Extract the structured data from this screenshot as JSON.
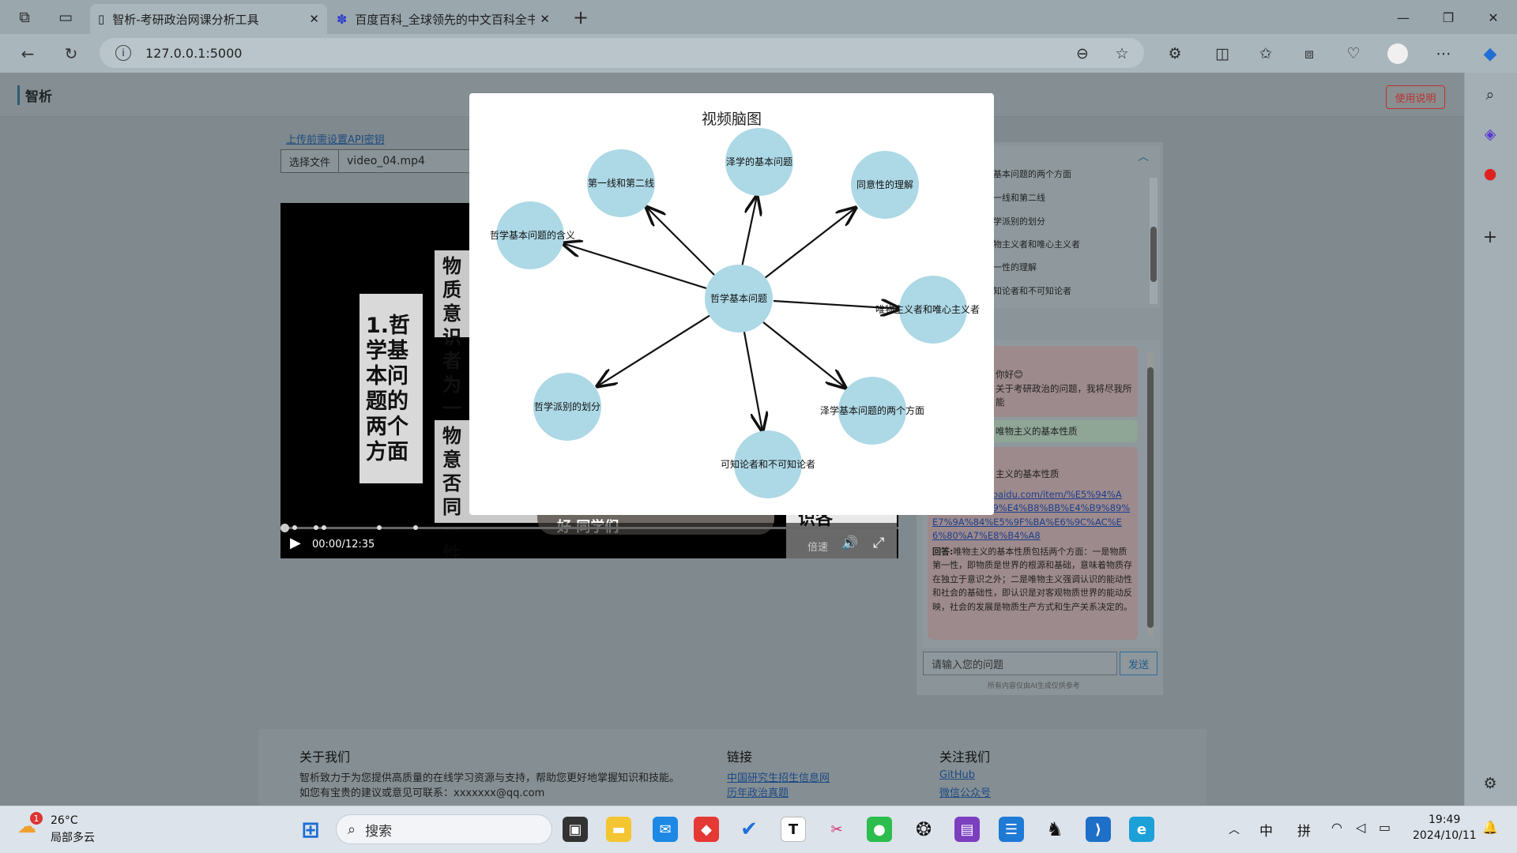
{
  "browser": {
    "tabs": [
      {
        "title": "智析-考研政治网课分析工具",
        "close": "✕"
      },
      {
        "title": "百度百科_全球领先的中文百科全书",
        "close": "✕"
      }
    ],
    "new_tab": "+",
    "url": "127.0.0.1:5000",
    "win": {
      "min": "—",
      "max": "❐",
      "close": "✕"
    }
  },
  "app": {
    "brand": "智析",
    "help_button": "使用说明",
    "api_link": "上传前需设置API密钥",
    "file_button": "选择文件",
    "file_name": "video_04.mp4"
  },
  "video": {
    "slide_title": "1.哲学基本问题的两个方面",
    "slide_right_1": "物质意识者为一性",
    "slide_right_2": "物意否同一性",
    "bottom_text": "好 同学们",
    "side_text": "识各",
    "time": "00:00/12:35",
    "speed": "倍速"
  },
  "outline": {
    "items": [
      "基本问题的两个方面",
      "一线和第二线",
      "学派别的划分",
      "物主义者和唯心主义者",
      "一性的理解",
      "知论者和不可知论者"
    ]
  },
  "chat": {
    "greeting": "你好😊",
    "intro": "关于考研政治的问题，我将尽我所能",
    "user_q": "唯物主义的基本性质",
    "bot_q": "主义的基本性质",
    "link": "https://baike.baidu.com/item/%E5%94%A F%E7%89%A9%E4%B8%BB%E4%B9%89%E7%9A%84%E5%9F%BA%E6%9C%AC%E6%80%A7%E8%B4%A8",
    "answer_label": "回答:",
    "answer": "唯物主义的基本性质包括两个方面：一是物质第一性，即物质是世界的根源和基础，意味着物质存在独立于意识之外；二是唯物主义强调认识的能动性和社会的基础性，即认识是对客观物质世界的能动反映，社会的发展是物质生产方式和生产关系决定的。",
    "input_placeholder": "请输入您的问题",
    "send": "发送",
    "disclaimer": "所有内容仅由AI生成仅供参考"
  },
  "footer": {
    "about_title": "关于我们",
    "about_1": "智析致力于为您提供高质量的在线学习资源与支持，帮助您更好地掌握知识和技能。",
    "about_2": "如您有宝贵的建议或意见可联系：xxxxxxx@qq.com",
    "links_title": "链接",
    "link_1": "中国研究生招生信息网",
    "link_2": "历年政治真题",
    "follow_title": "关注我们",
    "follow_1": "GitHub",
    "follow_2": "微信公众号"
  },
  "mindmap": {
    "title": "视频脑图",
    "center": "哲学基本问题",
    "nodes": [
      "泽学的基本问题",
      "第一线和第二线",
      "哲学基本问题的含义",
      "同意性的理解",
      "唯物主义者和唯心主义者",
      "哲学派别的划分",
      "可知论者和不可知论者",
      "泽学基本问题的两个方面"
    ]
  },
  "taskbar": {
    "weather_temp": "26°C",
    "weather_desc": "局部多云",
    "weather_badge": "1",
    "search": "搜索",
    "ime_1": "中",
    "ime_2": "拼",
    "time": "19:49",
    "date": "2024/10/11"
  }
}
